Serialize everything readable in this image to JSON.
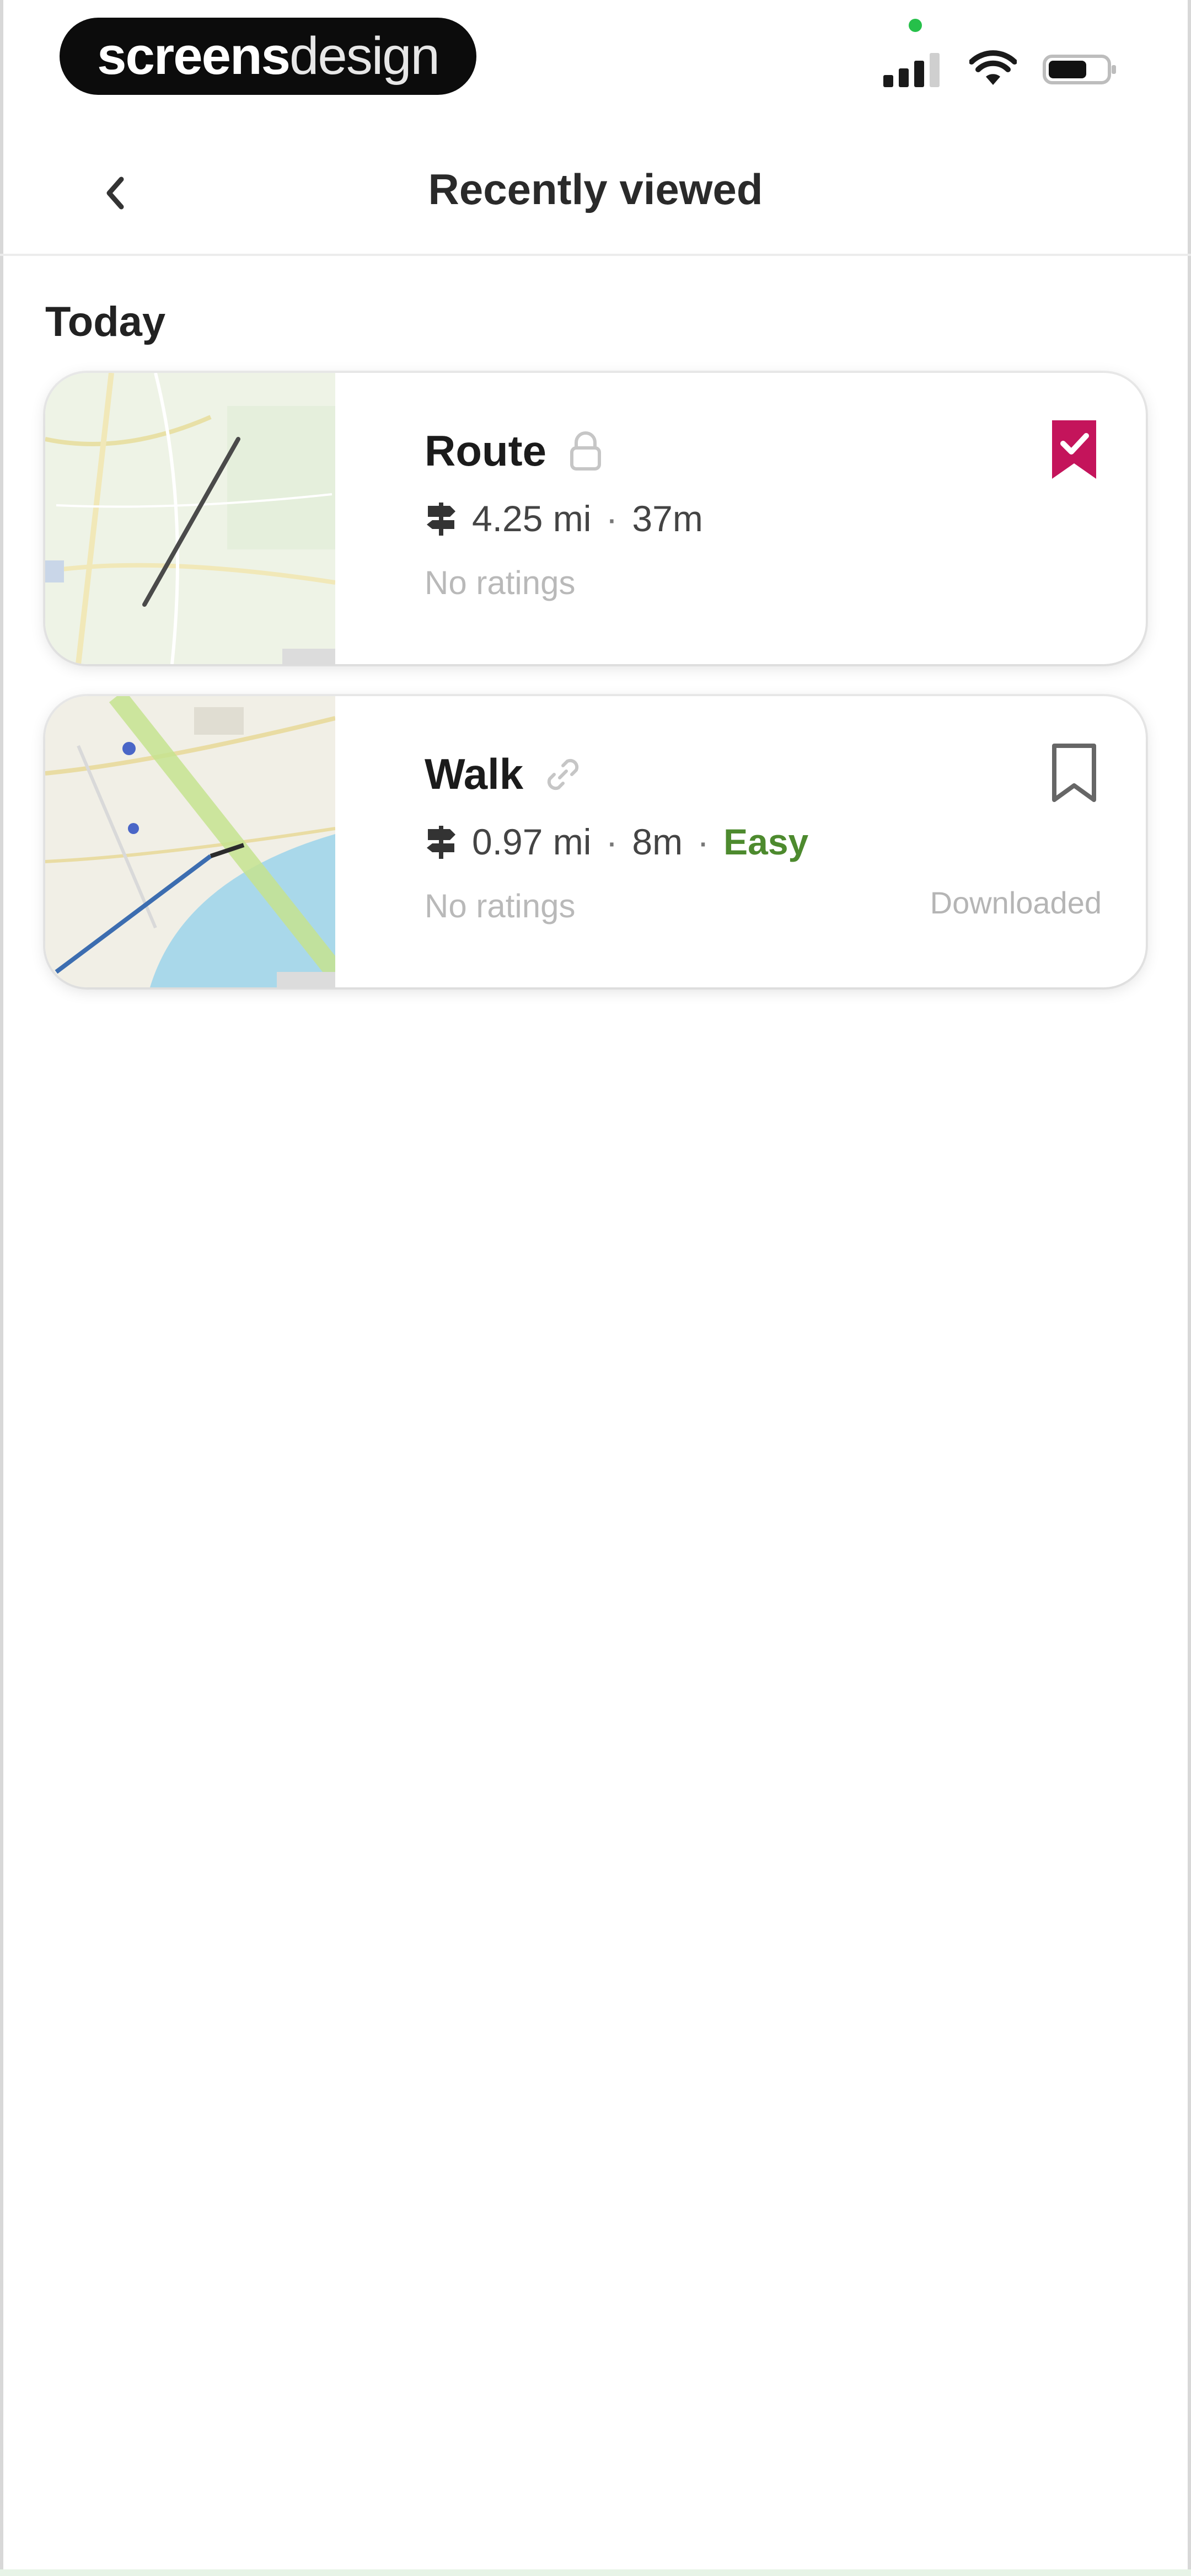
{
  "status_bar": {
    "brand_bold": "screens",
    "brand_light": "design"
  },
  "header": {
    "title": "Recently viewed"
  },
  "section": {
    "label": "Today"
  },
  "cards": [
    {
      "title": "Route",
      "distance": "4.25 mi",
      "duration": "37m",
      "rating": "No ratings",
      "bookmarked": true,
      "visibility_icon": "lock-icon",
      "accent": "#c4145b"
    },
    {
      "title": "Walk",
      "distance": "0.97 mi",
      "duration": "8m",
      "difficulty": "Easy",
      "rating": "No ratings",
      "status": "Downloaded",
      "bookmarked": false,
      "visibility_icon": "link-icon",
      "difficulty_color": "#4d8a2e"
    }
  ],
  "meta_separator": "·"
}
